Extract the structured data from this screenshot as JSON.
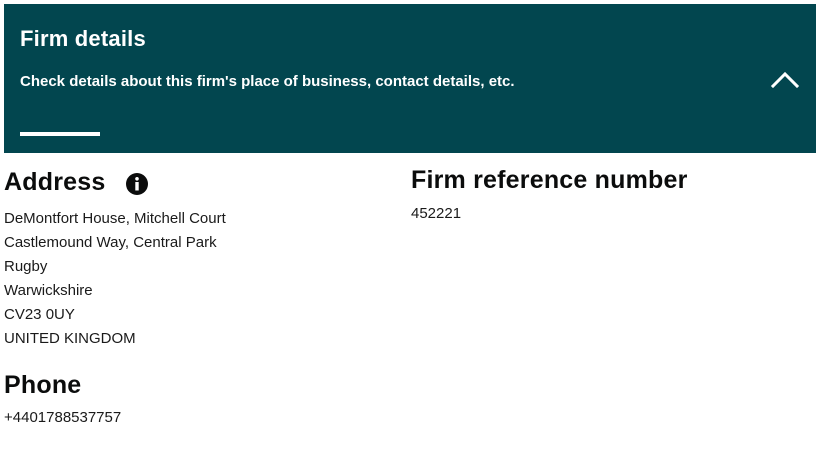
{
  "panel": {
    "title": "Firm details",
    "description": "Check details about this firm's place of business, contact details, etc.",
    "collapse_icon": "chevron-up-icon",
    "background": "#02464f"
  },
  "address": {
    "heading": "Address",
    "info_icon": "info-icon",
    "lines": [
      "DeMontfort House, Mitchell Court",
      "Castlemound Way, Central Park",
      "Rugby",
      "Warwickshire",
      "CV23 0UY",
      "UNITED KINGDOM"
    ]
  },
  "phone": {
    "heading": "Phone",
    "number": "+4401788537757"
  },
  "frn": {
    "heading": "Firm reference number",
    "number": "452221"
  }
}
